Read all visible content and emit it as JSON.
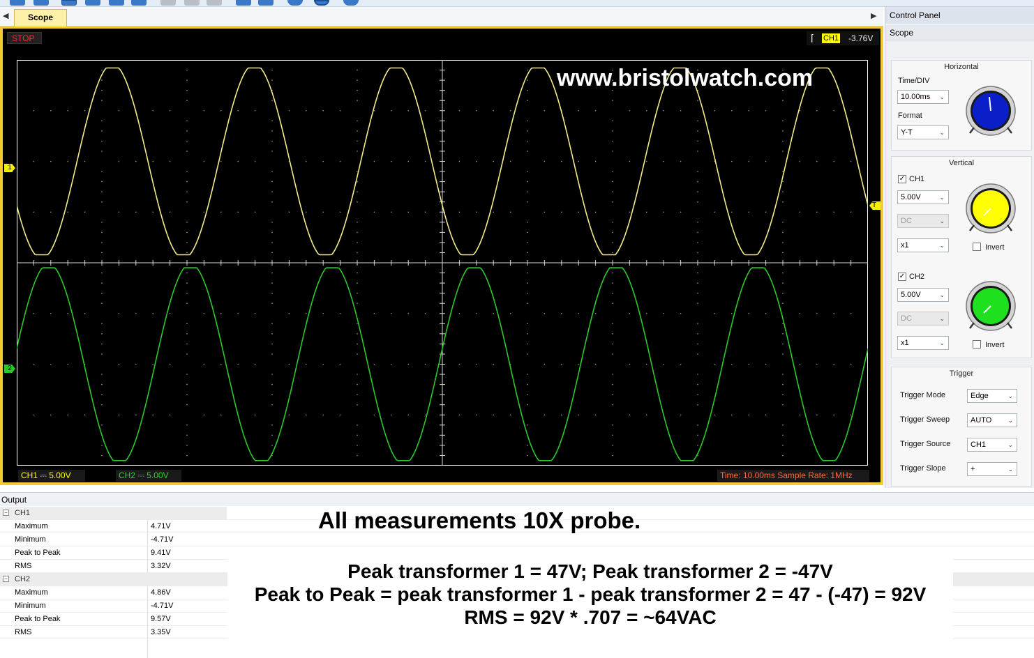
{
  "tabs": {
    "active_label": "Scope"
  },
  "scope": {
    "run_state": "STOP",
    "trigger_readout": {
      "channel": "CH1",
      "level": "-3.76V"
    },
    "watermark": "www.bristolwatch.com",
    "markers": {
      "ch1": "1",
      "ch2": "2",
      "trigger": "T"
    },
    "ch1_scale": "CH1 ⎓ 5.00V",
    "ch2_scale": "CH2 ⎓ 5.00V",
    "time_status": "Time: 10.00ms     Sample Rate: 1MHz",
    "colors": {
      "ch1": "#f3ec8a",
      "ch2": "#2ec82e",
      "grid": "#9a9a9a",
      "frame": "#f3c934"
    },
    "waveform": {
      "cycles_shown": 6,
      "ch1_amplitude_div": 1.88,
      "ch2_amplitude_div": 1.94,
      "ch1_offset_div": 2.0,
      "ch2_offset_div": -2.0
    }
  },
  "control_panel": {
    "title": "Control Panel",
    "subtitle": "Scope",
    "horizontal": {
      "title": "Horizontal",
      "time_div_label": "Time/DIV",
      "time_div_value": "10.00ms",
      "format_label": "Format",
      "format_value": "Y-T"
    },
    "vertical": {
      "title": "Vertical",
      "ch1": {
        "label": "CH1",
        "enabled": true,
        "volts": "5.00V",
        "coupling": "DC",
        "probe": "x1",
        "invert_label": "Invert"
      },
      "ch2": {
        "label": "CH2",
        "enabled": true,
        "volts": "5.00V",
        "coupling": "DC",
        "probe": "x1",
        "invert_label": "Invert"
      }
    },
    "trigger": {
      "title": "Trigger",
      "mode_label": "Trigger Mode",
      "mode_value": "Edge",
      "sweep_label": "Trigger Sweep",
      "sweep_value": "AUTO",
      "source_label": "Trigger Source",
      "source_value": "CH1",
      "slope_label": "Trigger Slope",
      "slope_value": "+"
    },
    "knob_colors": {
      "horizontal": "#0a1fc8",
      "ch1": "#ffff00",
      "ch2": "#1fe01f"
    }
  },
  "output": {
    "title": "Output",
    "groups": [
      {
        "name": "CH1",
        "rows": [
          {
            "k": "Maximum",
            "v": "4.71V"
          },
          {
            "k": "Minimum",
            "v": "-4.71V"
          },
          {
            "k": "Peak to Peak",
            "v": "9.41V"
          },
          {
            "k": "RMS",
            "v": "3.32V"
          }
        ]
      },
      {
        "name": "CH2",
        "rows": [
          {
            "k": "Maximum",
            "v": "4.86V"
          },
          {
            "k": "Minimum",
            "v": "-4.71V"
          },
          {
            "k": "Peak to Peak",
            "v": "9.57V"
          },
          {
            "k": "RMS",
            "v": "3.35V"
          }
        ]
      }
    ]
  },
  "annotation": {
    "title": "All measurements 10X probe.",
    "lines": [
      "Peak transformer 1 = 47V; Peak transformer 2 = -47V",
      "Peak to Peak = peak transformer 1 - peak transformer 2 = 47 - (-47) = 92V",
      "RMS = 92V * .707 = ~64VAC"
    ]
  }
}
